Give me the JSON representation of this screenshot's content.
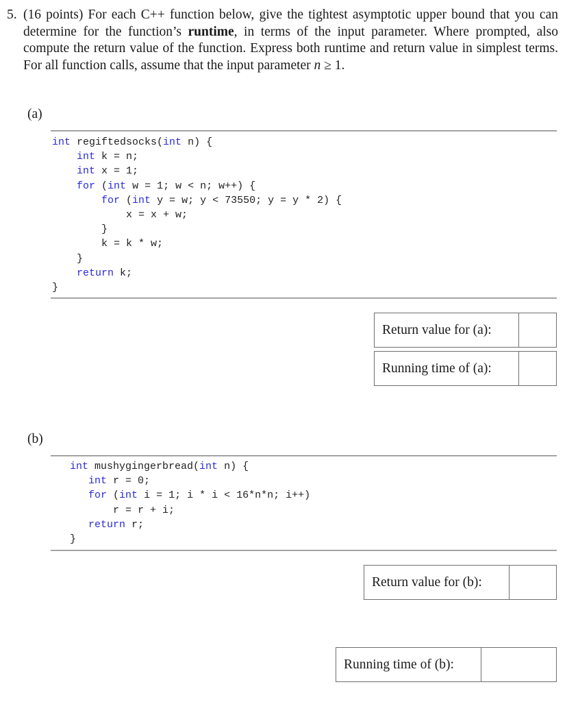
{
  "question": {
    "number": "5.",
    "points": "(16 points)",
    "text_before_bold": "For each C++ function below, give the tightest asymptotic upper bound that you can determine for the function’s ",
    "bold_word": "runtime",
    "text_after_bold": ", in terms of the input parameter. Where prompted, also compute the return value of the function. Express both runtime and return value in simplest terms.  For all function calls, assume that the input parameter ",
    "variable": "n",
    "condition": " ≥ 1."
  },
  "parts": [
    {
      "label": "(a)",
      "function_name": "regiftedsocks",
      "code_lines": [
        [
          {
            "t": "int",
            "k": 1
          },
          {
            "t": " regiftedsocks("
          },
          {
            "t": "int",
            "k": 1
          },
          {
            "t": " n) {"
          }
        ],
        [
          {
            "t": "    "
          },
          {
            "t": "int",
            "k": 1
          },
          {
            "t": " k = n;"
          }
        ],
        [
          {
            "t": "    "
          },
          {
            "t": "int",
            "k": 1
          },
          {
            "t": " x = 1;"
          }
        ],
        [
          {
            "t": "    "
          },
          {
            "t": "for",
            "k": 1
          },
          {
            "t": " ("
          },
          {
            "t": "int",
            "k": 1
          },
          {
            "t": " w = 1; w < n; w++) {"
          }
        ],
        [
          {
            "t": "        "
          },
          {
            "t": "for",
            "k": 1
          },
          {
            "t": " ("
          },
          {
            "t": "int",
            "k": 1
          },
          {
            "t": " y = w; y < 73550; y = y * 2) {"
          }
        ],
        [
          {
            "t": "            x = x + w;"
          }
        ],
        [
          {
            "t": "        }"
          }
        ],
        [
          {
            "t": "        k = k * w;"
          }
        ],
        [
          {
            "t": "    }"
          }
        ],
        [
          {
            "t": "    "
          },
          {
            "t": "return",
            "k": 1
          },
          {
            "t": " k;"
          }
        ],
        [
          {
            "t": "}"
          }
        ]
      ],
      "answers": [
        {
          "label": "Return value for (a):",
          "value": ""
        },
        {
          "label": "Running time of (a):",
          "value": ""
        }
      ]
    },
    {
      "label": "(b)",
      "function_name": "mushygingerbread",
      "code_lines": [
        [
          {
            "t": "int",
            "k": 1
          },
          {
            "t": " mushygingerbread("
          },
          {
            "t": "int",
            "k": 1
          },
          {
            "t": " n) {"
          }
        ],
        [
          {
            "t": "   "
          },
          {
            "t": "int",
            "k": 1
          },
          {
            "t": " r = 0;"
          }
        ],
        [
          {
            "t": "   "
          },
          {
            "t": "for",
            "k": 1
          },
          {
            "t": " ("
          },
          {
            "t": "int",
            "k": 1
          },
          {
            "t": " i = 1; i * i < 16*n*n; i++)"
          }
        ],
        [
          {
            "t": "       r = r + i;"
          }
        ],
        [
          {
            "t": "   "
          },
          {
            "t": "return",
            "k": 1
          },
          {
            "t": " r;"
          }
        ],
        [
          {
            "t": "}"
          }
        ]
      ],
      "answers": [
        {
          "label": "Return value for (b):",
          "value": ""
        },
        {
          "label": "Running time of (b):",
          "value": ""
        }
      ]
    }
  ],
  "colors": {
    "keyword": "#2b2bd6",
    "text": "#1a1a1a",
    "rule": "#8c8c8c"
  }
}
